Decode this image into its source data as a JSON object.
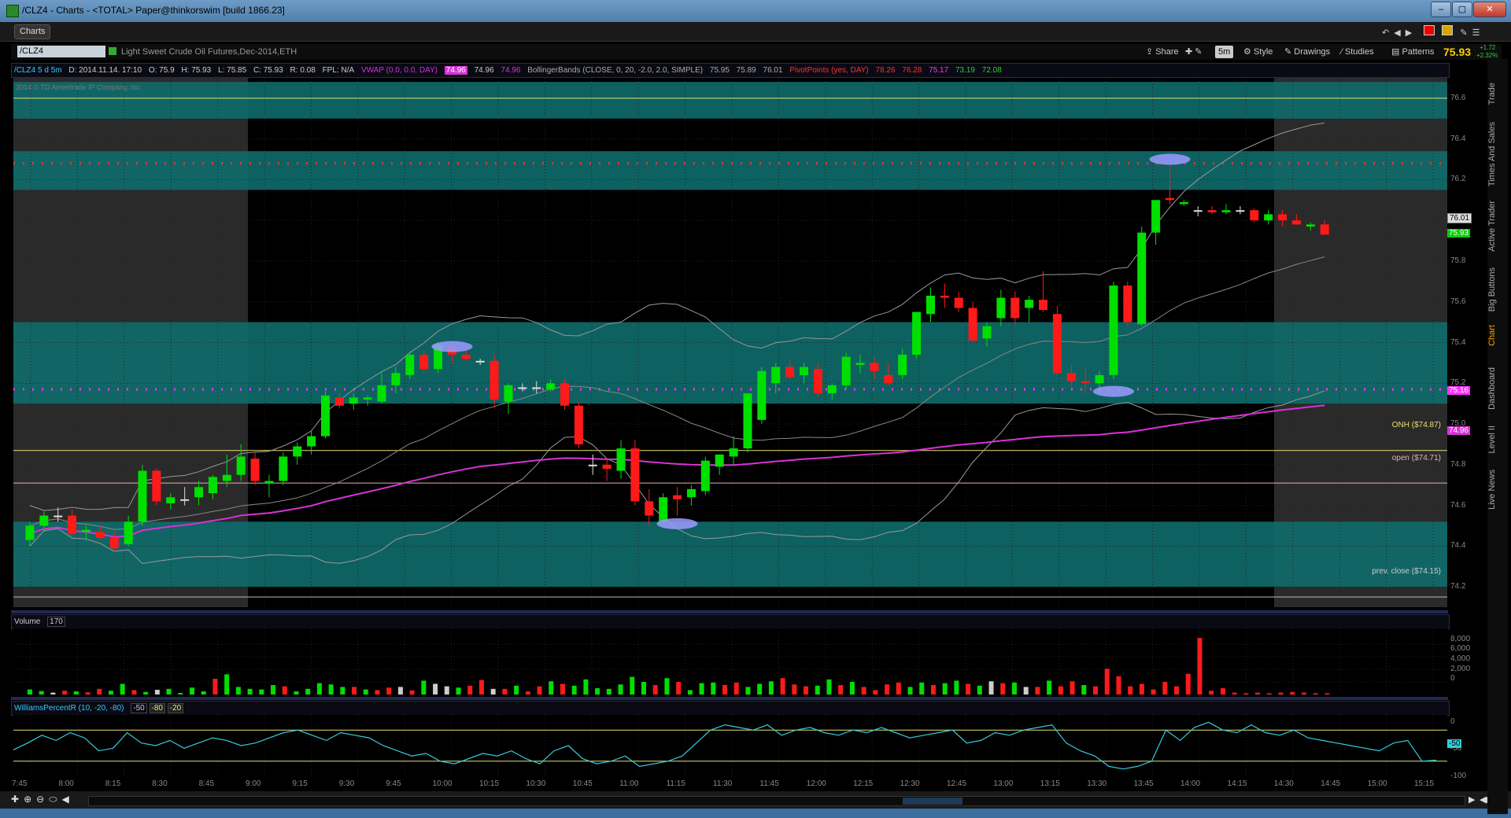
{
  "window": {
    "title": "/CLZ4 - Charts - <TOTAL> Paper@thinkorswim [build 1866.23]",
    "controls": [
      "–",
      "▢",
      "✕"
    ]
  },
  "tab": {
    "label": "Charts"
  },
  "symbol_bar": {
    "symbol": "/CLZ4",
    "description": "Light Sweet Crude Oil Futures,Dec-2014,ETH",
    "buttons": [
      "Share",
      "5m",
      "Style",
      "Drawings",
      "Studies",
      "Patterns"
    ],
    "last": "75.93",
    "change_up": "+1.72",
    "change_pct": "+2.32%"
  },
  "info_bar": {
    "symbol_period": "/CLZ4 5 d 5m",
    "date": "D: 2014.11.14. 17:10",
    "open": "O: 75.9",
    "high": "H: 75.93",
    "low": "L: 75.85",
    "close": "C: 75.93",
    "range": "R: 0.08",
    "fpl": "FPL: N/A",
    "vwap_label": "VWAP (0.0, 0.0, DAY)",
    "vwap_vals": [
      "74.96",
      "74.96",
      "74.96"
    ],
    "bb_label": "BollingerBands (CLOSE, 0, 20, -2.0, 2.0, SIMPLE)",
    "bb_vals": [
      "75.95",
      "75.89",
      "76.01"
    ],
    "pp_label": "PivotPoints (yes, DAY)",
    "pp_vals": [
      "78.26",
      "76.28",
      "75.17",
      "73.19",
      "72.08"
    ]
  },
  "copyright": "2014 © TD Ameritrade IP Company, Inc.",
  "price_axis": {
    "ticks": [
      "76.6",
      "76.4",
      "76.2",
      "76.0",
      "75.8",
      "75.6",
      "75.4",
      "75.2",
      "75.0",
      "74.8",
      "74.6",
      "74.4",
      "74.2"
    ],
    "labels": {
      "bb_upper": "76.01",
      "last": "75.93",
      "pivot": "75.16",
      "vwap": "74.96"
    }
  },
  "lines": {
    "onh": "ONH ($74.87)",
    "open": "open ($74.71)",
    "prev_close": "prev. close ($74.15)"
  },
  "volume": {
    "label": "Volume",
    "value": "170",
    "ticks": [
      "8,000",
      "6,000",
      "4,000",
      "2,000",
      "0"
    ]
  },
  "williams": {
    "label": "WilliamsPercentR (10, -20, -80)",
    "vals": [
      "-50",
      "-80",
      "-20"
    ],
    "ticks": [
      "0",
      "-50",
      "-100"
    ],
    "current": "-50"
  },
  "time_axis": [
    "7:45",
    "8:00",
    "8:15",
    "8:30",
    "8:45",
    "9:00",
    "9:15",
    "9:30",
    "9:45",
    "10:00",
    "10:15",
    "10:30",
    "10:45",
    "11:00",
    "11:15",
    "11:30",
    "11:45",
    "12:00",
    "12:15",
    "12:30",
    "12:45",
    "13:00",
    "13:15",
    "13:30",
    "13:45",
    "14:00",
    "14:15",
    "14:30",
    "14:45",
    "15:00",
    "15:15"
  ],
  "side_tabs": [
    "Trade",
    "Times And Sales",
    "Active Trader",
    "Big Buttons",
    "Chart",
    "Dashboard",
    "Level II",
    "Live News"
  ],
  "colors": {
    "up": "#00e000",
    "down": "#ff1a1a",
    "teal": "#0f6b6b",
    "vwap": "#d633d6",
    "pivot_red": "#ff3030",
    "pivot_mag": "#ff33ff"
  },
  "chart_data": {
    "type": "candlestick",
    "title": "/CLZ4 5 d 5m",
    "ylim": [
      74.1,
      76.7
    ],
    "candles": [
      [
        74.43,
        74.52,
        74.4,
        74.5
      ],
      [
        74.5,
        74.57,
        74.47,
        74.55
      ],
      [
        74.55,
        74.59,
        74.52,
        74.55
      ],
      [
        74.55,
        74.58,
        74.45,
        74.46
      ],
      [
        74.47,
        74.5,
        74.43,
        74.48
      ],
      [
        74.47,
        74.5,
        74.43,
        74.44
      ],
      [
        74.44,
        74.47,
        74.37,
        74.39
      ],
      [
        74.41,
        74.55,
        74.4,
        74.52
      ],
      [
        74.52,
        74.8,
        74.5,
        74.77
      ],
      [
        74.77,
        74.78,
        74.6,
        74.62
      ],
      [
        74.61,
        74.66,
        74.58,
        74.64
      ],
      [
        74.63,
        74.69,
        74.6,
        74.63
      ],
      [
        74.64,
        74.72,
        74.6,
        74.69
      ],
      [
        74.66,
        74.75,
        74.63,
        74.74
      ],
      [
        74.72,
        74.85,
        74.69,
        74.75
      ],
      [
        74.75,
        74.9,
        74.72,
        74.84
      ],
      [
        74.83,
        74.86,
        74.7,
        74.72
      ],
      [
        74.71,
        74.75,
        74.64,
        74.72
      ],
      [
        74.72,
        74.86,
        74.7,
        74.84
      ],
      [
        74.84,
        74.91,
        74.8,
        74.89
      ],
      [
        74.89,
        74.97,
        74.85,
        74.94
      ],
      [
        74.94,
        75.16,
        74.93,
        75.14
      ],
      [
        75.13,
        75.15,
        75.08,
        75.09
      ],
      [
        75.1,
        75.15,
        75.07,
        75.13
      ],
      [
        75.12,
        75.14,
        75.09,
        75.13
      ],
      [
        75.11,
        75.25,
        75.1,
        75.19
      ],
      [
        75.19,
        75.28,
        75.15,
        75.25
      ],
      [
        75.24,
        75.35,
        75.22,
        75.34
      ],
      [
        75.34,
        75.36,
        75.25,
        75.27
      ],
      [
        75.27,
        75.4,
        75.25,
        75.39
      ],
      [
        75.38,
        75.4,
        75.3,
        75.34
      ],
      [
        75.34,
        75.36,
        75.31,
        75.32
      ],
      [
        75.31,
        75.32,
        75.29,
        75.31
      ],
      [
        75.31,
        75.34,
        75.08,
        75.12
      ],
      [
        75.11,
        75.2,
        75.05,
        75.19
      ],
      [
        75.18,
        75.2,
        75.16,
        75.18
      ],
      [
        75.18,
        75.21,
        75.15,
        75.18
      ],
      [
        75.17,
        75.22,
        75.16,
        75.2
      ],
      [
        75.2,
        75.22,
        75.07,
        75.09
      ],
      [
        75.09,
        75.11,
        74.88,
        74.9
      ],
      [
        74.8,
        74.85,
        74.75,
        74.8
      ],
      [
        74.8,
        74.83,
        74.72,
        74.78
      ],
      [
        74.77,
        74.92,
        74.73,
        74.88
      ],
      [
        74.88,
        74.92,
        74.6,
        74.62
      ],
      [
        74.62,
        74.68,
        74.5,
        74.55
      ],
      [
        74.52,
        74.66,
        74.5,
        74.64
      ],
      [
        74.65,
        74.69,
        74.55,
        74.63
      ],
      [
        74.64,
        74.7,
        74.6,
        74.68
      ],
      [
        74.67,
        74.84,
        74.65,
        74.82
      ],
      [
        74.79,
        74.85,
        74.75,
        74.85
      ],
      [
        74.84,
        74.94,
        74.8,
        74.88
      ],
      [
        74.88,
        75.15,
        74.86,
        75.15
      ],
      [
        75.02,
        75.28,
        75.0,
        75.26
      ],
      [
        75.2,
        75.3,
        75.15,
        75.28
      ],
      [
        75.28,
        75.32,
        75.22,
        75.23
      ],
      [
        75.24,
        75.3,
        75.2,
        75.28
      ],
      [
        75.27,
        75.3,
        75.13,
        75.15
      ],
      [
        75.15,
        75.2,
        75.12,
        75.19
      ],
      [
        75.19,
        75.35,
        75.17,
        75.33
      ],
      [
        75.29,
        75.34,
        75.25,
        75.3
      ],
      [
        75.3,
        75.33,
        75.22,
        75.26
      ],
      [
        75.24,
        75.3,
        75.19,
        75.2
      ],
      [
        75.24,
        75.37,
        75.22,
        75.34
      ],
      [
        75.34,
        75.55,
        75.32,
        75.55
      ],
      [
        75.54,
        75.67,
        75.5,
        75.63
      ],
      [
        75.63,
        75.69,
        75.57,
        75.62
      ],
      [
        75.62,
        75.65,
        75.55,
        75.57
      ],
      [
        75.57,
        75.6,
        75.4,
        75.41
      ],
      [
        75.42,
        75.5,
        75.38,
        75.48
      ],
      [
        75.52,
        75.66,
        75.48,
        75.62
      ],
      [
        75.62,
        75.65,
        75.49,
        75.52
      ],
      [
        75.57,
        75.63,
        75.5,
        75.61
      ],
      [
        75.61,
        75.75,
        75.55,
        75.56
      ],
      [
        75.54,
        75.58,
        75.24,
        75.25
      ],
      [
        75.25,
        75.29,
        75.18,
        75.21
      ],
      [
        75.21,
        75.27,
        75.15,
        75.2
      ],
      [
        75.2,
        75.26,
        75.16,
        75.24
      ],
      [
        75.24,
        75.7,
        75.22,
        75.68
      ],
      [
        75.68,
        75.7,
        75.48,
        75.5
      ],
      [
        75.49,
        75.97,
        75.48,
        75.94
      ],
      [
        75.94,
        76.1,
        75.88,
        76.1
      ],
      [
        76.11,
        76.3,
        76.08,
        76.1
      ],
      [
        76.08,
        76.1,
        76.07,
        76.09
      ],
      [
        76.05,
        76.07,
        76.02,
        76.05
      ],
      [
        76.05,
        76.07,
        76.03,
        76.04
      ],
      [
        76.04,
        76.08,
        76.03,
        76.05
      ],
      [
        76.05,
        76.07,
        76.03,
        76.05
      ],
      [
        76.05,
        76.06,
        75.99,
        76.0
      ],
      [
        76.0,
        76.05,
        75.98,
        76.03
      ],
      [
        76.03,
        76.05,
        75.97,
        76.0
      ],
      [
        76.0,
        76.03,
        75.98,
        75.98
      ],
      [
        75.97,
        75.99,
        75.95,
        75.98
      ],
      [
        75.98,
        76.0,
        75.93,
        75.93
      ]
    ],
    "volume": [
      800,
      550,
      300,
      600,
      500,
      350,
      900,
      600,
      1700,
      700,
      400,
      750,
      900,
      250,
      1100,
      500,
      2500,
      3200,
      1200,
      900,
      800,
      1500,
      1300,
      500,
      900,
      1800,
      1600,
      1200,
      1200,
      800,
      700,
      1100,
      1200,
      650,
      2200,
      1700,
      1300,
      1100,
      1400,
      2300,
      900,
      900,
      1400,
      500,
      1300,
      2100,
      1700,
      1400,
      2400,
      1000,
      900,
      1600,
      2800,
      2000,
      1500,
      2600,
      2000,
      700,
      1800,
      1900,
      1500,
      1900,
      1200,
      1700,
      2100,
      2600,
      1600,
      1300,
      1400,
      2400,
      1500,
      2000,
      1200,
      700,
      1600,
      1900,
      1200,
      1900,
      1500,
      1800,
      2200,
      1700,
      1400,
      2100,
      1800,
      1900,
      1200,
      1200,
      2200,
      1300,
      2100,
      1500,
      1300,
      4100,
      2900,
      1300,
      1700,
      800,
      2000,
      1300,
      3300,
      9000,
      600,
      1000,
      300,
      200,
      300,
      200,
      300,
      400,
      300,
      200,
      200
    ],
    "volume_colors": "mixed",
    "williams_r": [
      -58,
      -45,
      -30,
      -40,
      -25,
      -35,
      -60,
      -55,
      -25,
      -45,
      -50,
      -40,
      -55,
      -45,
      -35,
      -40,
      -50,
      -45,
      -35,
      -25,
      -20,
      -30,
      -40,
      -25,
      -30,
      -35,
      -50,
      -60,
      -70,
      -65,
      -80,
      -85,
      -75,
      -65,
      -70,
      -60,
      -75,
      -85,
      -60,
      -50,
      -75,
      -85,
      -80,
      -70,
      -90,
      -85,
      -80,
      -70,
      -45,
      -20,
      -10,
      -15,
      -20,
      -10,
      -30,
      -20,
      -15,
      -25,
      -30,
      -20,
      -25,
      -15,
      -25,
      -35,
      -30,
      -25,
      -20,
      -45,
      -40,
      -25,
      -30,
      -20,
      -15,
      -10,
      -45,
      -60,
      -70,
      -90,
      -95,
      -90,
      -80,
      -20,
      -40,
      -15,
      -5,
      -20,
      -25,
      -10,
      -25,
      -30,
      -20,
      -35,
      -40,
      -45,
      -50,
      -55,
      -60,
      -45,
      -40,
      -80,
      -78
    ]
  }
}
